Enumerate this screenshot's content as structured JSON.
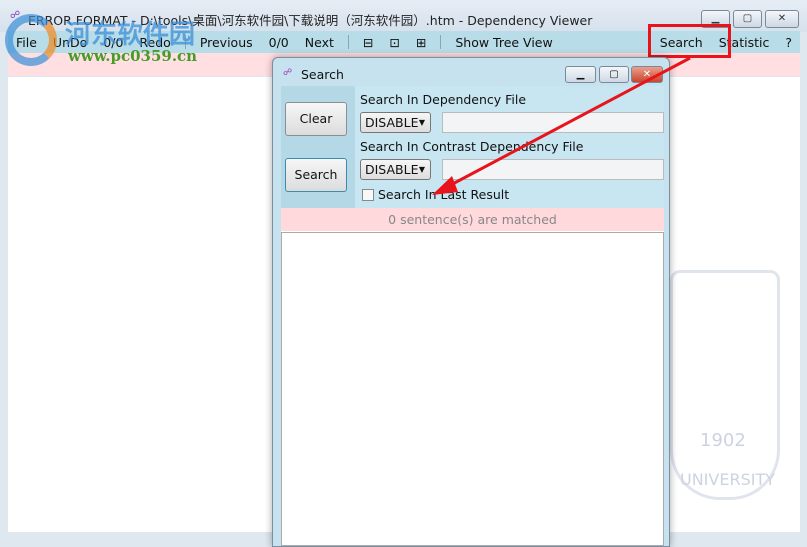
{
  "window": {
    "title": "ERROR FORMAT - D:\\tools\\桌面\\河东软件园\\下载说明（河东软件园）.htm - Dependency Viewer",
    "icon": "app-icon"
  },
  "toolbar": {
    "file": "File",
    "undo": "UnDo",
    "undo_count": "0/0",
    "redo": "Redo",
    "previous": "Previous",
    "match_count": "0/0",
    "next": "Next",
    "collapse": "⊟",
    "restore": "⊡",
    "expand": "⊞",
    "tree": "Show Tree View",
    "search": "Search",
    "statistic": "Statistic",
    "help": "?"
  },
  "watermark": {
    "logo_text": "河东软件园",
    "url": "www.pc0359.cn",
    "seal_year": "1902",
    "seal_text": "UNIVERSITY"
  },
  "dialog": {
    "title": "Search",
    "clear": "Clear",
    "search": "Search",
    "dep_label": "Search In Dependency File",
    "dep_select": "DISABLE",
    "dep_value": "",
    "contrast_label": "Search In Contrast Dependency File",
    "contrast_select": "DISABLE",
    "contrast_value": "",
    "last_result": "Search In Last Result",
    "last_result_checked": false,
    "status": "0 sentence(s) are matched"
  },
  "colors": {
    "toolbar": "#b8dce8",
    "status_pink": "#ffdfe2",
    "highlight": "#e8141b"
  }
}
